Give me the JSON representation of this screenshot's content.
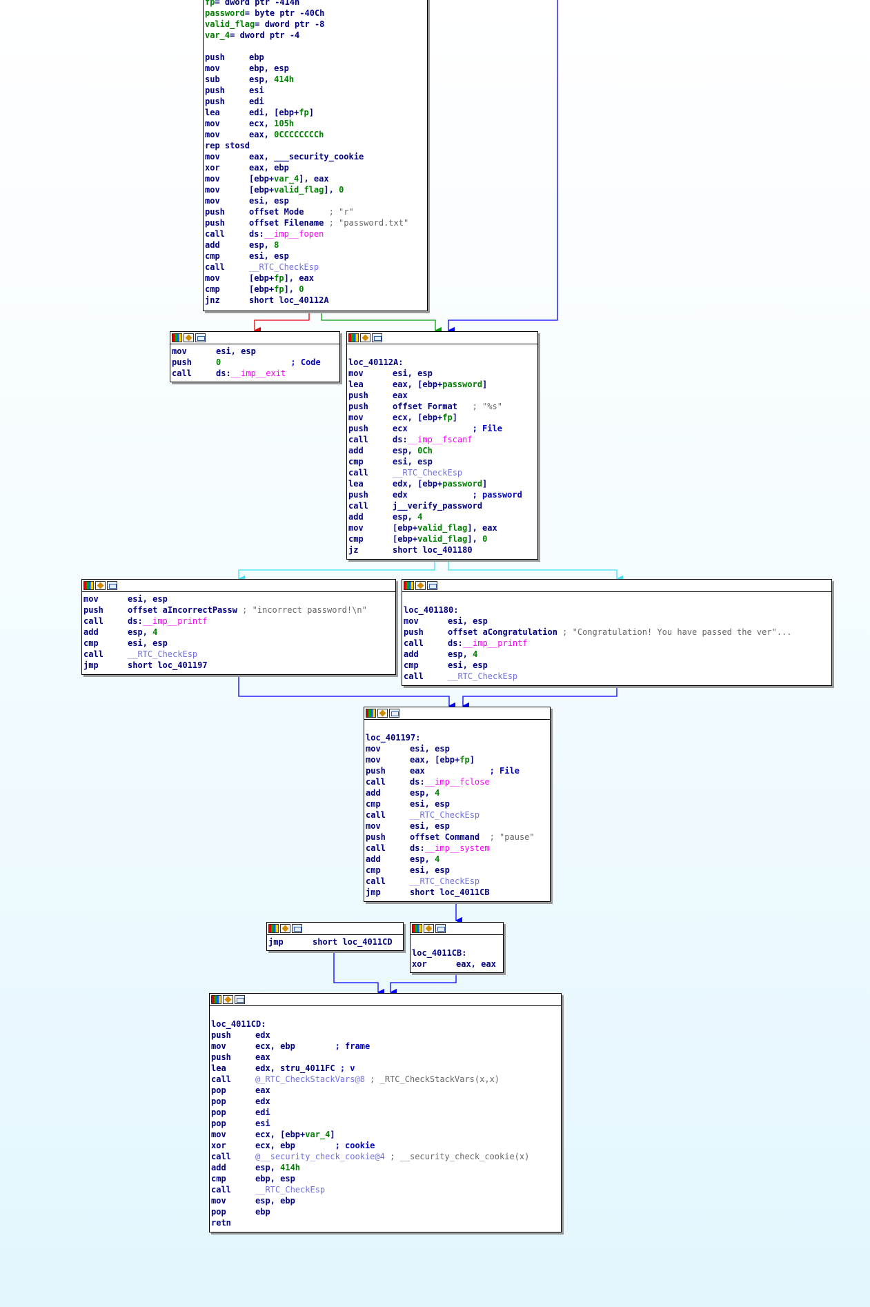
{
  "nodes": [
    {
      "id": "entry",
      "lines": [
        [
          [
            "var",
            "fp"
          ],
          [
            "op",
            "= dword ptr -414h"
          ]
        ],
        [
          [
            "var",
            "password"
          ],
          [
            "op",
            "= byte ptr -40Ch"
          ]
        ],
        [
          [
            "var",
            "valid_flag"
          ],
          [
            "op",
            "= dword ptr -8"
          ]
        ],
        [
          [
            "var",
            "var_4"
          ],
          [
            "op",
            "= dword ptr -4"
          ]
        ],
        [],
        [
          [
            "mn",
            "push"
          ],
          [
            "op",
            "ebp"
          ]
        ],
        [
          [
            "mn",
            "mov"
          ],
          [
            "op",
            "ebp, esp"
          ]
        ],
        [
          [
            "mn",
            "sub"
          ],
          [
            "op",
            "esp, "
          ],
          [
            "num",
            "414h"
          ]
        ],
        [
          [
            "mn",
            "push"
          ],
          [
            "op",
            "esi"
          ]
        ],
        [
          [
            "mn",
            "push"
          ],
          [
            "op",
            "edi"
          ]
        ],
        [
          [
            "mn",
            "lea"
          ],
          [
            "op",
            "edi, [ebp+"
          ],
          [
            "var",
            "fp"
          ],
          [
            "op",
            "]"
          ]
        ],
        [
          [
            "mn",
            "mov"
          ],
          [
            "op",
            "ecx, "
          ],
          [
            "num",
            "105h"
          ]
        ],
        [
          [
            "mn",
            "mov"
          ],
          [
            "op",
            "eax, "
          ],
          [
            "num",
            "0CCCCCCCCh"
          ]
        ],
        [
          [
            "op",
            "rep stosd"
          ]
        ],
        [
          [
            "mn",
            "mov"
          ],
          [
            "op",
            "eax, "
          ],
          [
            "op",
            "___security_cookie"
          ]
        ],
        [
          [
            "mn",
            "xor"
          ],
          [
            "op",
            "eax, ebp"
          ]
        ],
        [
          [
            "mn",
            "mov"
          ],
          [
            "op",
            "[ebp+"
          ],
          [
            "var",
            "var_4"
          ],
          [
            "op",
            "], eax"
          ]
        ],
        [
          [
            "mn",
            "mov"
          ],
          [
            "op",
            "[ebp+"
          ],
          [
            "var",
            "valid_flag"
          ],
          [
            "op",
            "], "
          ],
          [
            "num",
            "0"
          ]
        ],
        [
          [
            "mn",
            "mov"
          ],
          [
            "op",
            "esi, esp"
          ]
        ],
        [
          [
            "mn",
            "push"
          ],
          [
            "op",
            "offset Mode     "
          ],
          [
            "cmt",
            "; \"r\""
          ]
        ],
        [
          [
            "mn",
            "push"
          ],
          [
            "op",
            "offset Filename "
          ],
          [
            "cmt",
            "; \"password.txt\""
          ]
        ],
        [
          [
            "mn",
            "call"
          ],
          [
            "op",
            "ds:"
          ],
          [
            "fn",
            "__imp__fopen"
          ]
        ],
        [
          [
            "mn",
            "add"
          ],
          [
            "op",
            "esp, "
          ],
          [
            "num",
            "8"
          ]
        ],
        [
          [
            "mn",
            "cmp"
          ],
          [
            "op",
            "esi, esp"
          ]
        ],
        [
          [
            "mn",
            "call"
          ],
          [
            "lib",
            "__RTC_CheckEsp"
          ]
        ],
        [
          [
            "mn",
            "mov"
          ],
          [
            "op",
            "[ebp+"
          ],
          [
            "var",
            "fp"
          ],
          [
            "op",
            "], eax"
          ]
        ],
        [
          [
            "mn",
            "cmp"
          ],
          [
            "op",
            "[ebp+"
          ],
          [
            "var",
            "fp"
          ],
          [
            "op",
            "], "
          ],
          [
            "num",
            "0"
          ]
        ],
        [
          [
            "mn",
            "jnz"
          ],
          [
            "op",
            "short loc_40112A"
          ]
        ]
      ]
    },
    {
      "id": "exit",
      "lines": [
        [
          [
            "mn",
            "mov"
          ],
          [
            "op",
            "esi, esp"
          ]
        ],
        [
          [
            "mn",
            "push"
          ],
          [
            "num",
            "0"
          ],
          [
            "op",
            "              "
          ],
          [
            "cmtb",
            "; Code"
          ]
        ],
        [
          [
            "mn",
            "call"
          ],
          [
            "op",
            "ds:"
          ],
          [
            "fn",
            "__imp__exit"
          ]
        ]
      ]
    },
    {
      "id": "loc_40112A",
      "lines": [
        [],
        [
          [
            "lbl",
            "loc_40112A:"
          ]
        ],
        [
          [
            "mn",
            "mov"
          ],
          [
            "op",
            "esi, esp"
          ]
        ],
        [
          [
            "mn",
            "lea"
          ],
          [
            "op",
            "eax, [ebp+"
          ],
          [
            "var",
            "password"
          ],
          [
            "op",
            "]"
          ]
        ],
        [
          [
            "mn",
            "push"
          ],
          [
            "op",
            "eax"
          ]
        ],
        [
          [
            "mn",
            "push"
          ],
          [
            "op",
            "offset Format   "
          ],
          [
            "cmt",
            "; \"%s\""
          ]
        ],
        [
          [
            "mn",
            "mov"
          ],
          [
            "op",
            "ecx, [ebp+"
          ],
          [
            "var",
            "fp"
          ],
          [
            "op",
            "]"
          ]
        ],
        [
          [
            "mn",
            "push"
          ],
          [
            "op",
            "ecx             "
          ],
          [
            "cmtb",
            "; File"
          ]
        ],
        [
          [
            "mn",
            "call"
          ],
          [
            "op",
            "ds:"
          ],
          [
            "fn",
            "__imp__fscanf"
          ]
        ],
        [
          [
            "mn",
            "add"
          ],
          [
            "op",
            "esp, "
          ],
          [
            "num",
            "0Ch"
          ]
        ],
        [
          [
            "mn",
            "cmp"
          ],
          [
            "op",
            "esi, esp"
          ]
        ],
        [
          [
            "mn",
            "call"
          ],
          [
            "lib",
            "__RTC_CheckEsp"
          ]
        ],
        [
          [
            "mn",
            "lea"
          ],
          [
            "op",
            "edx, [ebp+"
          ],
          [
            "var",
            "password"
          ],
          [
            "op",
            "]"
          ]
        ],
        [
          [
            "mn",
            "push"
          ],
          [
            "op",
            "edx             "
          ],
          [
            "cmtb",
            "; password"
          ]
        ],
        [
          [
            "mn",
            "call"
          ],
          [
            "op",
            "j__verify_password"
          ]
        ],
        [
          [
            "mn",
            "add"
          ],
          [
            "op",
            "esp, "
          ],
          [
            "num",
            "4"
          ]
        ],
        [
          [
            "mn",
            "mov"
          ],
          [
            "op",
            "[ebp+"
          ],
          [
            "var",
            "valid_flag"
          ],
          [
            "op",
            "], eax"
          ]
        ],
        [
          [
            "mn",
            "cmp"
          ],
          [
            "op",
            "[ebp+"
          ],
          [
            "var",
            "valid_flag"
          ],
          [
            "op",
            "], "
          ],
          [
            "num",
            "0"
          ]
        ],
        [
          [
            "mn",
            "jz"
          ],
          [
            "op",
            "short loc_401180"
          ]
        ]
      ]
    },
    {
      "id": "incorrect",
      "lines": [
        [
          [
            "mn",
            "mov"
          ],
          [
            "op",
            "esi, esp"
          ]
        ],
        [
          [
            "mn",
            "push"
          ],
          [
            "op",
            "offset aIncorrectPassw "
          ],
          [
            "cmt",
            "; \"incorrect password!\\n\""
          ]
        ],
        [
          [
            "mn",
            "call"
          ],
          [
            "op",
            "ds:"
          ],
          [
            "fn",
            "__imp__printf"
          ]
        ],
        [
          [
            "mn",
            "add"
          ],
          [
            "op",
            "esp, "
          ],
          [
            "num",
            "4"
          ]
        ],
        [
          [
            "mn",
            "cmp"
          ],
          [
            "op",
            "esi, esp"
          ]
        ],
        [
          [
            "mn",
            "call"
          ],
          [
            "lib",
            "__RTC_CheckEsp"
          ]
        ],
        [
          [
            "mn",
            "jmp"
          ],
          [
            "op",
            "short loc_401197"
          ]
        ]
      ]
    },
    {
      "id": "loc_401180",
      "lines": [
        [],
        [
          [
            "lbl",
            "loc_401180:"
          ]
        ],
        [
          [
            "mn",
            "mov"
          ],
          [
            "op",
            "esi, esp"
          ]
        ],
        [
          [
            "mn",
            "push"
          ],
          [
            "op",
            "offset aCongratulation "
          ],
          [
            "cmt",
            "; \"Congratulation! You have passed the ver\"..."
          ]
        ],
        [
          [
            "mn",
            "call"
          ],
          [
            "op",
            "ds:"
          ],
          [
            "fn",
            "__imp__printf"
          ]
        ],
        [
          [
            "mn",
            "add"
          ],
          [
            "op",
            "esp, "
          ],
          [
            "num",
            "4"
          ]
        ],
        [
          [
            "mn",
            "cmp"
          ],
          [
            "op",
            "esi, esp"
          ]
        ],
        [
          [
            "mn",
            "call"
          ],
          [
            "lib",
            "__RTC_CheckEsp"
          ]
        ]
      ]
    },
    {
      "id": "loc_401197",
      "lines": [
        [],
        [
          [
            "lbl",
            "loc_401197:"
          ]
        ],
        [
          [
            "mn",
            "mov"
          ],
          [
            "op",
            "esi, esp"
          ]
        ],
        [
          [
            "mn",
            "mov"
          ],
          [
            "op",
            "eax, [ebp+"
          ],
          [
            "var",
            "fp"
          ],
          [
            "op",
            "]"
          ]
        ],
        [
          [
            "mn",
            "push"
          ],
          [
            "op",
            "eax             "
          ],
          [
            "cmtb",
            "; File"
          ]
        ],
        [
          [
            "mn",
            "call"
          ],
          [
            "op",
            "ds:"
          ],
          [
            "fn",
            "__imp__fclose"
          ]
        ],
        [
          [
            "mn",
            "add"
          ],
          [
            "op",
            "esp, "
          ],
          [
            "num",
            "4"
          ]
        ],
        [
          [
            "mn",
            "cmp"
          ],
          [
            "op",
            "esi, esp"
          ]
        ],
        [
          [
            "mn",
            "call"
          ],
          [
            "lib",
            "__RTC_CheckEsp"
          ]
        ],
        [
          [
            "mn",
            "mov"
          ],
          [
            "op",
            "esi, esp"
          ]
        ],
        [
          [
            "mn",
            "push"
          ],
          [
            "op",
            "offset Command  "
          ],
          [
            "cmt",
            "; \"pause\""
          ]
        ],
        [
          [
            "mn",
            "call"
          ],
          [
            "op",
            "ds:"
          ],
          [
            "fn",
            "__imp__system"
          ]
        ],
        [
          [
            "mn",
            "add"
          ],
          [
            "op",
            "esp, "
          ],
          [
            "num",
            "4"
          ]
        ],
        [
          [
            "mn",
            "cmp"
          ],
          [
            "op",
            "esi, esp"
          ]
        ],
        [
          [
            "mn",
            "call"
          ],
          [
            "lib",
            "__RTC_CheckEsp"
          ]
        ],
        [
          [
            "mn",
            "jmp"
          ],
          [
            "op",
            "short loc_4011CB"
          ]
        ]
      ]
    },
    {
      "id": "jmp_4011CD",
      "lines": [
        [
          [
            "mn",
            "jmp"
          ],
          [
            "op",
            "short loc_4011CD"
          ]
        ]
      ]
    },
    {
      "id": "loc_4011CB",
      "lines": [
        [],
        [
          [
            "lbl",
            "loc_4011CB:"
          ]
        ],
        [
          [
            "mn",
            "xor"
          ],
          [
            "op",
            "eax, eax"
          ]
        ]
      ]
    },
    {
      "id": "loc_4011CD",
      "lines": [
        [],
        [
          [
            "lbl",
            "loc_4011CD:"
          ]
        ],
        [
          [
            "mn",
            "push"
          ],
          [
            "op",
            "edx"
          ]
        ],
        [
          [
            "mn",
            "mov"
          ],
          [
            "op",
            "ecx, ebp        "
          ],
          [
            "cmtb",
            "; frame"
          ]
        ],
        [
          [
            "mn",
            "push"
          ],
          [
            "op",
            "eax"
          ]
        ],
        [
          [
            "mn",
            "lea"
          ],
          [
            "op",
            "edx, stru_4011FC "
          ],
          [
            "cmtb",
            "; v"
          ]
        ],
        [
          [
            "mn",
            "call"
          ],
          [
            "lib",
            "@_RTC_CheckStackVars@8"
          ],
          [
            "cmt",
            " ; _RTC_CheckStackVars(x,x)"
          ]
        ],
        [
          [
            "mn",
            "pop"
          ],
          [
            "op",
            "eax"
          ]
        ],
        [
          [
            "mn",
            "pop"
          ],
          [
            "op",
            "edx"
          ]
        ],
        [
          [
            "mn",
            "pop"
          ],
          [
            "op",
            "edi"
          ]
        ],
        [
          [
            "mn",
            "pop"
          ],
          [
            "op",
            "esi"
          ]
        ],
        [
          [
            "mn",
            "mov"
          ],
          [
            "op",
            "ecx, [ebp+"
          ],
          [
            "var",
            "var_4"
          ],
          [
            "op",
            "]"
          ]
        ],
        [
          [
            "mn",
            "xor"
          ],
          [
            "op",
            "ecx, ebp        "
          ],
          [
            "cmtb",
            "; cookie"
          ]
        ],
        [
          [
            "mn",
            "call"
          ],
          [
            "lib",
            "@__security_check_cookie@4"
          ],
          [
            "cmt",
            " ; __security_check_cookie(x)"
          ]
        ],
        [
          [
            "mn",
            "add"
          ],
          [
            "op",
            "esp, "
          ],
          [
            "num",
            "414h"
          ]
        ],
        [
          [
            "mn",
            "cmp"
          ],
          [
            "op",
            "ebp, esp"
          ]
        ],
        [
          [
            "mn",
            "call"
          ],
          [
            "lib",
            "__RTC_CheckEsp"
          ]
        ],
        [
          [
            "mn",
            "mov"
          ],
          [
            "op",
            "esp, ebp"
          ]
        ],
        [
          [
            "mn",
            "pop"
          ],
          [
            "op",
            "ebp"
          ]
        ],
        [
          [
            "mn",
            "retn"
          ]
        ]
      ]
    }
  ],
  "edge_colors": {
    "true": "#00a000",
    "false": "#e00000",
    "uncond": "#0000ff",
    "branch": "#40e0f0"
  }
}
